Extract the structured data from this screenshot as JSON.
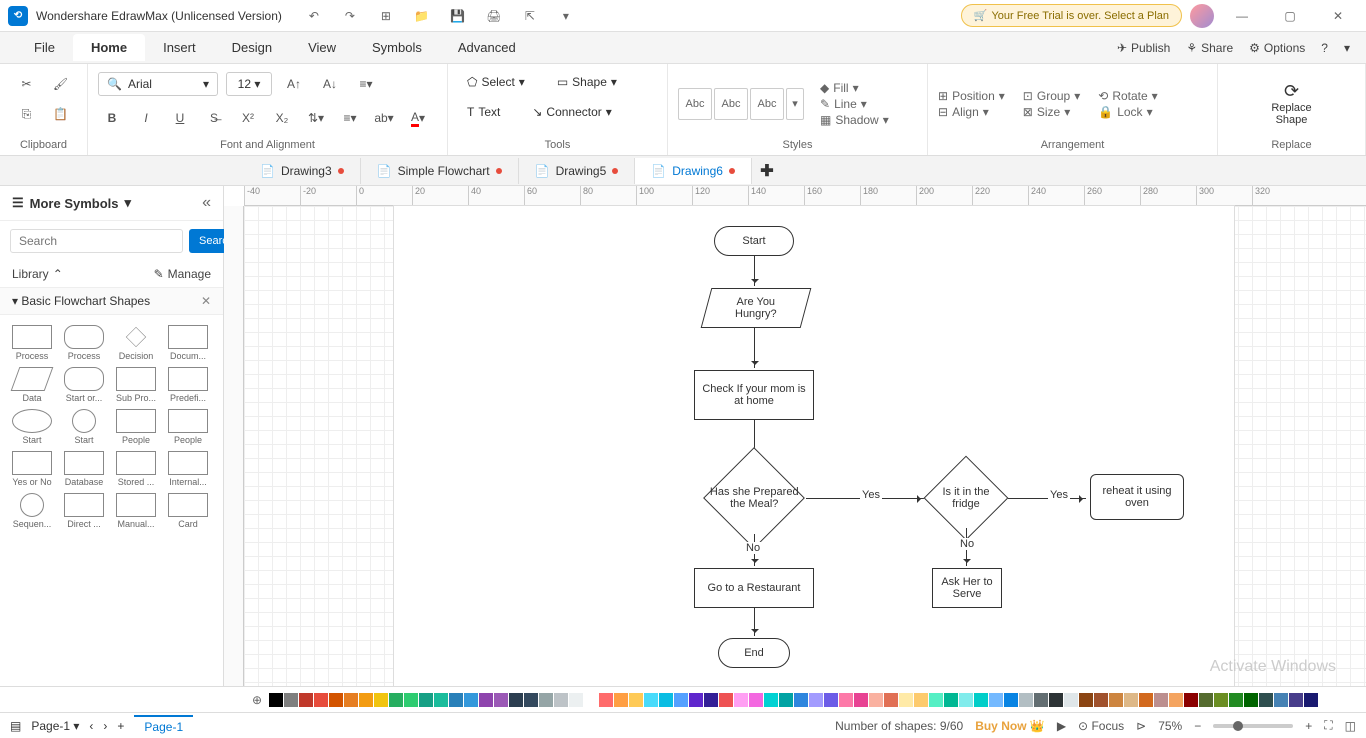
{
  "app": {
    "title": "Wondershare EdrawMax (Unlicensed Version)"
  },
  "trial": {
    "text": "Your Free Trial is over. Select a Plan"
  },
  "menu": {
    "items": [
      "File",
      "Home",
      "Insert",
      "Design",
      "View",
      "Symbols",
      "Advanced"
    ],
    "active": "Home",
    "right": {
      "publish": "Publish",
      "share": "Share",
      "options": "Options"
    }
  },
  "ribbon": {
    "clipboard": "Clipboard",
    "font_align": "Font and Alignment",
    "tools": "Tools",
    "styles": "Styles",
    "arrangement": "Arrangement",
    "replace": "Replace",
    "font_name": "Arial",
    "font_size": "12",
    "select": "Select",
    "shape": "Shape",
    "text": "Text",
    "connector": "Connector",
    "abc": "Abc",
    "fill": "Fill",
    "line": "Line",
    "shadow": "Shadow",
    "position": "Position",
    "align": "Align",
    "group": "Group",
    "size": "Size",
    "rotate": "Rotate",
    "lock": "Lock",
    "replace_shape": "Replace\nShape"
  },
  "doctabs": [
    {
      "label": "Drawing3",
      "dirty": true
    },
    {
      "label": "Simple Flowchart",
      "dirty": true
    },
    {
      "label": "Drawing5",
      "dirty": true
    },
    {
      "label": "Drawing6",
      "dirty": true,
      "active": true
    }
  ],
  "sidebar": {
    "title": "More Symbols",
    "search_placeholder": "Search",
    "search_btn": "Search",
    "library": "Library",
    "manage": "Manage",
    "section": "Basic Flowchart Shapes",
    "shapes": [
      [
        "Process",
        "Process",
        "Decision",
        "Docum..."
      ],
      [
        "Data",
        "Start or...",
        "Sub Pro...",
        "Predefi..."
      ],
      [
        "Start",
        "Start",
        "People",
        "People"
      ],
      [
        "Yes or No",
        "Database",
        "Stored ...",
        "Internal..."
      ],
      [
        "Sequen...",
        "Direct ...",
        "Manual...",
        "Card"
      ]
    ]
  },
  "ruler_marks": [
    "-40",
    "-20",
    "0",
    "20",
    "40",
    "60",
    "80",
    "100",
    "120",
    "140",
    "160",
    "180",
    "200",
    "220",
    "240",
    "260",
    "280",
    "300",
    "320"
  ],
  "flowchart": {
    "start": "Start",
    "hungry": "Are You\nHungry?",
    "check_mom": "Check If your mom is\nat home",
    "prepared": "Has she Prepared\nthe Meal?",
    "yes1": "Yes",
    "no1": "No",
    "restaurant": "Go to a Restaurant",
    "end": "End",
    "fridge": "Is it in the\nfridge",
    "yes2": "Yes",
    "no2": "No",
    "serve": "Ask Her to\nServe",
    "reheat": "reheat it using\noven"
  },
  "watermark": "Activate Windows",
  "colors": [
    "#000000",
    "#7f7f7f",
    "#c0392b",
    "#e74c3c",
    "#d35400",
    "#e67e22",
    "#f39c12",
    "#f1c40f",
    "#27ae60",
    "#2ecc71",
    "#16a085",
    "#1abc9c",
    "#2980b9",
    "#3498db",
    "#8e44ad",
    "#9b59b6",
    "#2c3e50",
    "#34495e",
    "#95a5a6",
    "#bdc3c7",
    "#ecf0f1",
    "#ffffff",
    "#ff6b6b",
    "#ff9f43",
    "#feca57",
    "#48dbfb",
    "#0abde3",
    "#54a0ff",
    "#5f27cd",
    "#341f97",
    "#ee5253",
    "#ff9ff3",
    "#f368e0",
    "#00d2d3",
    "#01a3a4",
    "#2e86de",
    "#a29bfe",
    "#6c5ce7",
    "#fd79a8",
    "#e84393",
    "#fab1a0",
    "#e17055",
    "#ffeaa7",
    "#fdcb6e",
    "#55efc4",
    "#00b894",
    "#81ecec",
    "#00cec9",
    "#74b9ff",
    "#0984e3",
    "#b2bec3",
    "#636e72",
    "#2d3436",
    "#dfe6e9",
    "#8b4513",
    "#a0522d",
    "#cd853f",
    "#deb887",
    "#d2691e",
    "#bc8f8f",
    "#f4a460",
    "#8b0000",
    "#556b2f",
    "#6b8e23",
    "#228b22",
    "#006400",
    "#2f4f4f",
    "#4682b4",
    "#483d8b",
    "#191970"
  ],
  "status": {
    "page": "Page-1",
    "page_tab": "Page-1",
    "shapes": "Number of shapes: 9/60",
    "buy": "Buy Now",
    "focus": "Focus",
    "zoom": "75%"
  }
}
